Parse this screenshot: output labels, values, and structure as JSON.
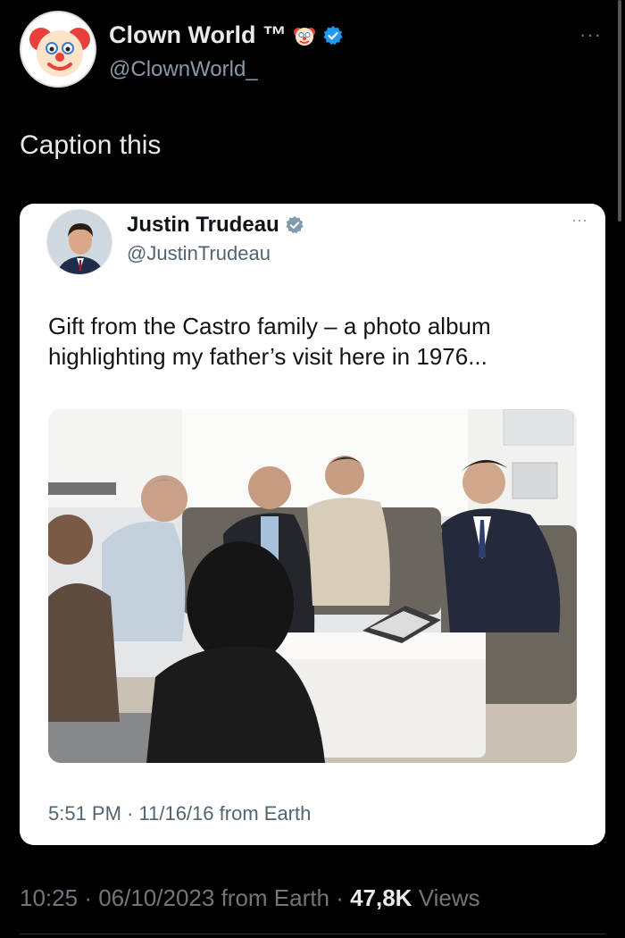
{
  "outer_tweet": {
    "display_name": "Clown World ™",
    "handle": "@ClownWorld_",
    "text": "Caption this",
    "more_label": "···"
  },
  "quoted_tweet": {
    "display_name": "Justin Trudeau",
    "handle": "@JustinTrudeau",
    "more_label": "···",
    "text": "Gift from the Castro family – a photo album highlighting my father’s visit here in 1976...",
    "time": "5:51 PM",
    "date": "11/16/16",
    "source": "from Earth"
  },
  "meta": {
    "time": "10:25",
    "date": "06/10/2023",
    "source": "from Earth",
    "views_count": "47,8K",
    "views_label": "Views"
  },
  "colors": {
    "verified": "#1d9bf0",
    "background": "#000000",
    "card": "#ffffff"
  },
  "icons": [
    "clown-face-icon",
    "verified-badge-icon",
    "more-icon"
  ]
}
